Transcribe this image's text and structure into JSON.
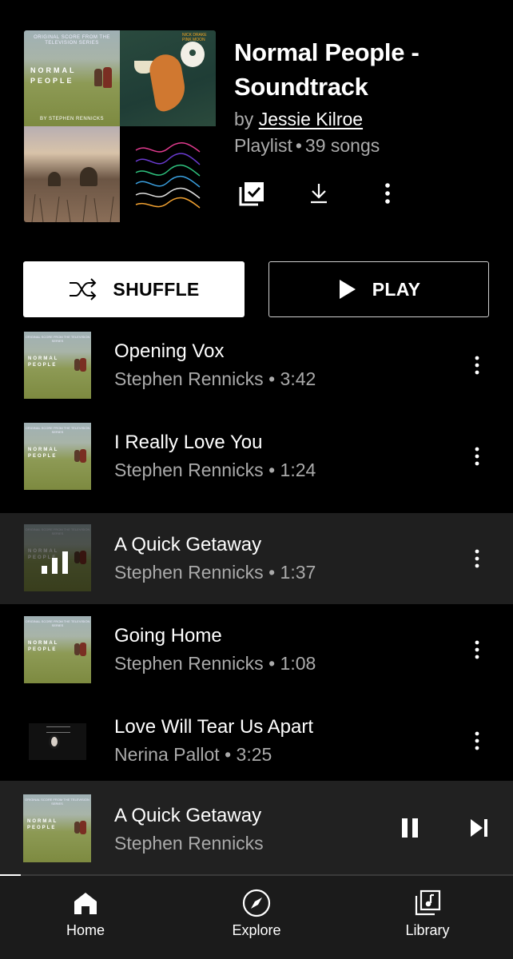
{
  "playlist": {
    "title": "Normal People - Soundtrack",
    "by_prefix": "by",
    "artist": "Jessie Kilroe",
    "type": "Playlist",
    "separator": "•",
    "song_count": "39 songs"
  },
  "collage": {
    "cover1_caption": "ORIGINAL SCORE FROM THE TELEVISION SERIES",
    "cover1_title_line1": "NORMAL",
    "cover1_title_line2": "PEOPLE",
    "cover1_byline": "BY STEPHEN RENNICKS",
    "cover2_caption": "NICK DRAKE PINK MOON"
  },
  "actions": {
    "save_icon": "library-add-check-icon",
    "download_icon": "download-icon",
    "more_icon": "more-vert-icon"
  },
  "buttons": {
    "shuffle_label": "SHUFFLE",
    "play_label": "PLAY"
  },
  "tracks": [
    {
      "title": "Opening Vox",
      "artist": "Stephen Rennicks",
      "duration": "3:42",
      "playing": false
    },
    {
      "title": "I Really Love You",
      "artist": "Stephen Rennicks",
      "duration": "1:24",
      "playing": false
    },
    {
      "title": "A Quick Getaway",
      "artist": "Stephen Rennicks",
      "duration": "1:37",
      "playing": true
    },
    {
      "title": "Going Home",
      "artist": "Stephen Rennicks",
      "duration": "1:08",
      "playing": false
    },
    {
      "title": "Love Will Tear Us Apart",
      "artist": "Nerina Pallot",
      "duration": "3:25",
      "playing": false
    }
  ],
  "now_playing": {
    "title": "A Quick Getaway",
    "artist": "Stephen Rennicks",
    "progress": 0.04
  },
  "nav": [
    {
      "label": "Home",
      "icon": "home-icon"
    },
    {
      "label": "Explore",
      "icon": "compass-icon"
    },
    {
      "label": "Library",
      "icon": "library-music-icon"
    }
  ],
  "colors": {
    "background": "#000000",
    "secondary_text": "#aaaaaa",
    "active_row": "#1f1f1f",
    "mini_player": "#212121",
    "nav_bar": "#1b1b1b"
  }
}
